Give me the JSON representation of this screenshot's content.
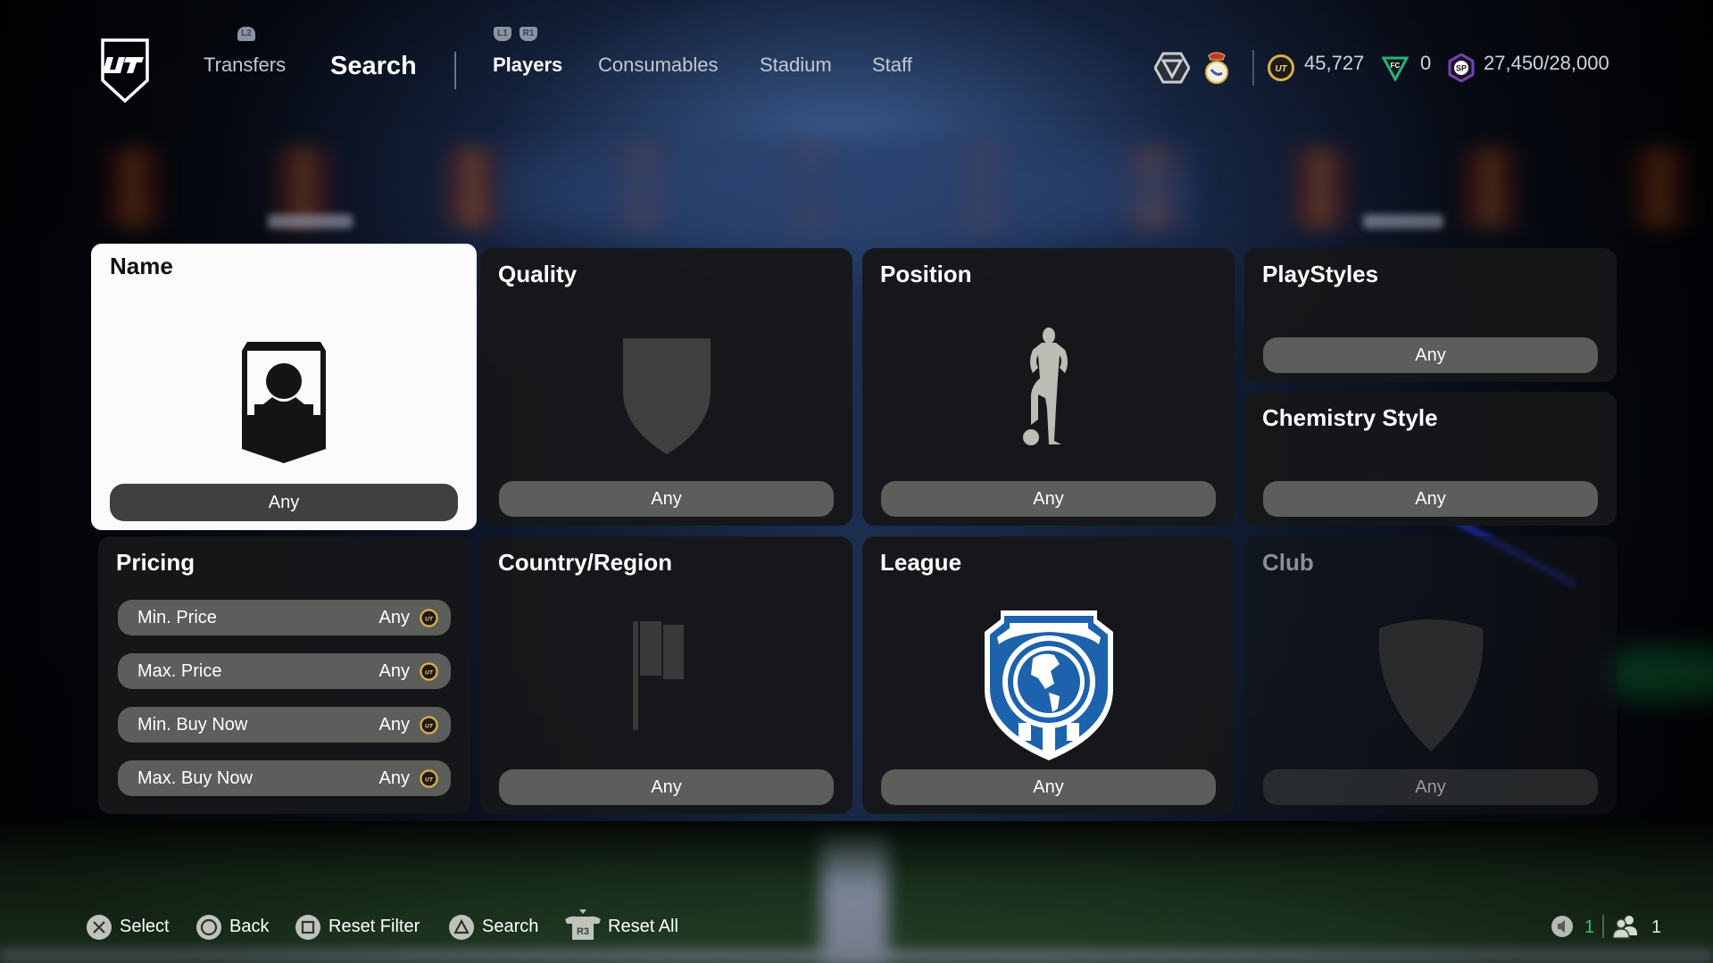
{
  "header": {
    "primary_tabs": [
      {
        "label": "Transfers",
        "hint": "L2",
        "active": false
      },
      {
        "label": "Search",
        "active": true
      }
    ],
    "sub_tabs": {
      "hints": [
        "L1",
        "R1"
      ],
      "items": [
        {
          "label": "Players",
          "active": true
        },
        {
          "label": "Consumables",
          "active": false
        },
        {
          "label": "Stadium",
          "active": false
        },
        {
          "label": "Staff",
          "active": false
        }
      ]
    },
    "icons": [
      "division-rank-icon",
      "club-badge-icon"
    ],
    "currencies": {
      "coins": "45,727",
      "fc_points": "0",
      "season_points": "27,450/28,000"
    },
    "colors": {
      "coin_gold": "#d8b04a",
      "fc_points_green": "#27b27c",
      "sp_purple": "#7a3fb8"
    }
  },
  "filters": {
    "name": {
      "title": "Name",
      "value": "Any",
      "selected": true
    },
    "quality": {
      "title": "Quality",
      "value": "Any"
    },
    "position": {
      "title": "Position",
      "value": "Any"
    },
    "playstyles": {
      "title": "PlayStyles",
      "value": "Any"
    },
    "chemistry_style": {
      "title": "Chemistry Style",
      "value": "Any"
    },
    "pricing": {
      "title": "Pricing",
      "rows": [
        {
          "label": "Min. Price",
          "value": "Any"
        },
        {
          "label": "Max. Price",
          "value": "Any"
        },
        {
          "label": "Min. Buy Now",
          "value": "Any"
        },
        {
          "label": "Max. Buy Now",
          "value": "Any"
        }
      ]
    },
    "country": {
      "title": "Country/Region",
      "value": "Any"
    },
    "league": {
      "title": "League",
      "value": "Any"
    },
    "club": {
      "title": "Club",
      "value": "Any",
      "disabled": true
    }
  },
  "footer": {
    "controls": [
      {
        "button": "cross",
        "label": "Select"
      },
      {
        "button": "circle",
        "label": "Back"
      },
      {
        "button": "square",
        "label": "Reset Filter"
      },
      {
        "button": "triangle",
        "label": "Search"
      },
      {
        "button": "R3",
        "label": "Reset All"
      }
    ],
    "status": {
      "voice_count": "1",
      "party_count": "1"
    },
    "colors": {
      "voice_active": "#2ecc5e"
    }
  }
}
